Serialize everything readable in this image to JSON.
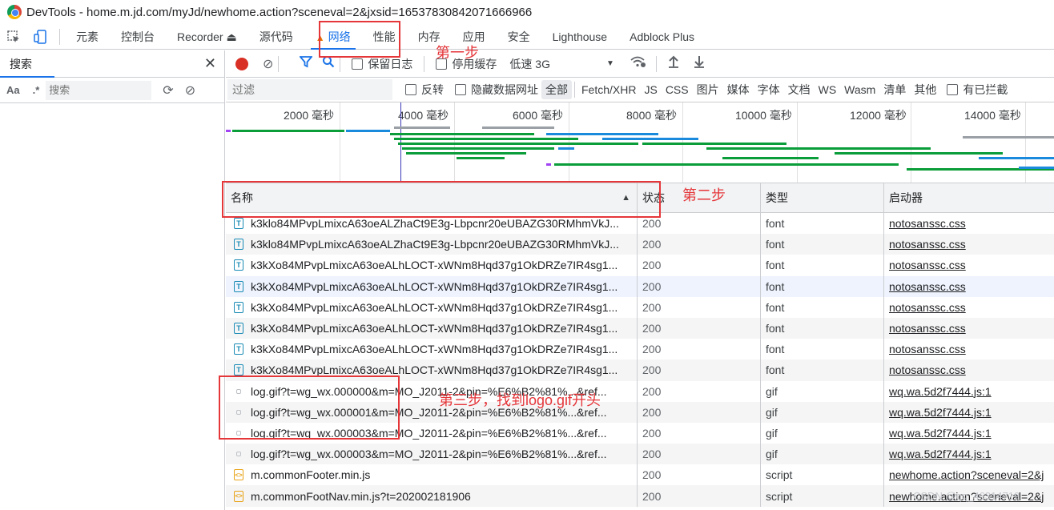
{
  "window": {
    "title": "DevTools - home.m.jd.com/myJd/newhome.action?sceneval=2&jxsid=16537830842071666966"
  },
  "tabs": [
    {
      "label": "元素"
    },
    {
      "label": "控制台"
    },
    {
      "label": "Recorder ⏏"
    },
    {
      "label": "源代码"
    },
    {
      "label": "网络"
    },
    {
      "label": "性能"
    },
    {
      "label": "内存"
    },
    {
      "label": "应用"
    },
    {
      "label": "安全"
    },
    {
      "label": "Lighthouse"
    },
    {
      "label": "Adblock Plus"
    }
  ],
  "search_panel": {
    "title": "搜索",
    "case_label": "Aa",
    "regex_label": ".*",
    "placeholder": "搜索"
  },
  "toolbar": {
    "preserve_log": "保留日志",
    "disable_cache": "停用缓存",
    "throttle": "低速 3G"
  },
  "filter": {
    "placeholder": "过滤",
    "invert": "反转",
    "hide_data_urls": "隐藏数据网址",
    "types": [
      "全部",
      "Fetch/XHR",
      "JS",
      "CSS",
      "图片",
      "媒体",
      "字体",
      "文档",
      "WS",
      "Wasm",
      "清单",
      "其他"
    ],
    "blocked": "有已拦截"
  },
  "overview": {
    "ticks": [
      "2000 毫秒",
      "4000 毫秒",
      "6000 毫秒",
      "8000 毫秒",
      "10000 毫秒",
      "12000 毫秒",
      "14000 毫秒"
    ]
  },
  "columns": {
    "name": "名称",
    "status": "状态",
    "type": "类型",
    "initiator": "启动器"
  },
  "rows": [
    {
      "name": "k3klo84MPvpLmixcA63oeALZhaCt9E3g-Lbpcnr20eUBAZG30RMhmVkJ...",
      "status": "200",
      "type": "font",
      "initiator": "notosanssc.css",
      "icon": "T"
    },
    {
      "name": "k3klo84MPvpLmixcA63oeALZhaCt9E3g-Lbpcnr20eUBAZG30RMhmVkJ...",
      "status": "200",
      "type": "font",
      "initiator": "notosanssc.css",
      "icon": "T"
    },
    {
      "name": "k3kXo84MPvpLmixcA63oeALhLOCT-xWNm8Hqd37g1OkDRZe7IR4sg1...",
      "status": "200",
      "type": "font",
      "initiator": "notosanssc.css",
      "icon": "T"
    },
    {
      "name": "k3kXo84MPvpLmixcA63oeALhLOCT-xWNm8Hqd37g1OkDRZe7IR4sg1...",
      "status": "200",
      "type": "font",
      "initiator": "notosanssc.css",
      "icon": "T"
    },
    {
      "name": "k3kXo84MPvpLmixcA63oeALhLOCT-xWNm8Hqd37g1OkDRZe7IR4sg1...",
      "status": "200",
      "type": "font",
      "initiator": "notosanssc.css",
      "icon": "T"
    },
    {
      "name": "k3kXo84MPvpLmixcA63oeALhLOCT-xWNm8Hqd37g1OkDRZe7IR4sg1...",
      "status": "200",
      "type": "font",
      "initiator": "notosanssc.css",
      "icon": "T"
    },
    {
      "name": "k3kXo84MPvpLmixcA63oeALhLOCT-xWNm8Hqd37g1OkDRZe7IR4sg1...",
      "status": "200",
      "type": "font",
      "initiator": "notosanssc.css",
      "icon": "T"
    },
    {
      "name": "k3kXo84MPvpLmixcA63oeALhLOCT-xWNm8Hqd37g1OkDRZe7IR4sg1...",
      "status": "200",
      "type": "font",
      "initiator": "notosanssc.css",
      "icon": "T"
    },
    {
      "name": "log.gif?t=wg_wx.000000&m=MO_J2011-2&pin=%E6%B2%81%...&ref...",
      "status": "200",
      "type": "gif",
      "initiator": "wq.wa.5d2f7444.js:1",
      "icon": "gif"
    },
    {
      "name": "log.gif?t=wg_wx.000001&m=MO_J2011-2&pin=%E6%B2%81%...&ref...",
      "status": "200",
      "type": "gif",
      "initiator": "wq.wa.5d2f7444.js:1",
      "icon": "gif"
    },
    {
      "name": "log.gif?t=wg_wx.000003&m=MO_J2011-2&pin=%E6%B2%81%...&ref...",
      "status": "200",
      "type": "gif",
      "initiator": "wq.wa.5d2f7444.js:1",
      "icon": "gif"
    },
    {
      "name": "log.gif?t=wg_wx.000003&m=MO_J2011-2&pin=%E6%B2%81%...&ref...",
      "status": "200",
      "type": "gif",
      "initiator": "wq.wa.5d2f7444.js:1",
      "icon": "gif"
    },
    {
      "name": "m.commonFooter.min.js",
      "status": "200",
      "type": "script",
      "initiator": "newhome.action?sceneval=2&j",
      "icon": "script"
    },
    {
      "name": "m.commonFootNav.min.js?t=202002181906",
      "status": "200",
      "type": "script",
      "initiator": "newhome.action?sceneval=2&j",
      "icon": "script"
    }
  ],
  "annotations": {
    "step1": "第一步",
    "step2": "第二步",
    "step3": "第三步，找到logo.gif开头"
  },
  "watermark": "CSDN @qq_46314719",
  "colors": {
    "accent": "#1a73e8",
    "record": "#d93025",
    "annotation": "#e5363a",
    "warning": "#e37400"
  }
}
